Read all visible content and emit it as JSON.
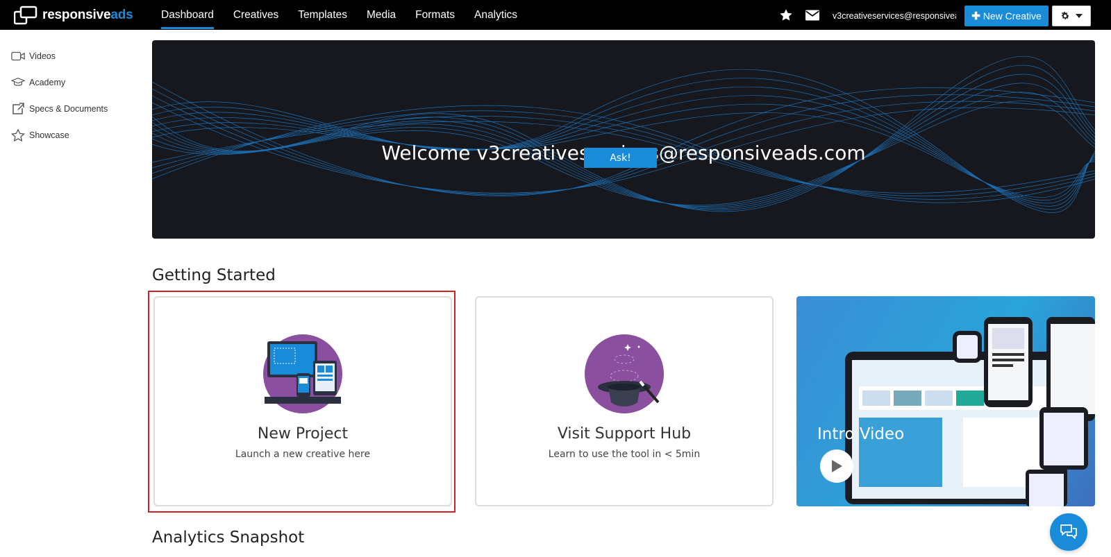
{
  "header": {
    "logo_main": "responsive",
    "logo_accent": "ads",
    "nav": [
      {
        "label": "Dashboard",
        "active": true
      },
      {
        "label": "Creatives"
      },
      {
        "label": "Templates"
      },
      {
        "label": "Media"
      },
      {
        "label": "Formats"
      },
      {
        "label": "Analytics"
      }
    ],
    "user_email": "v3creativeservices@responsivea...",
    "new_creative_label": "New Creative",
    "settings_icon": "gear-icon"
  },
  "sidebar": {
    "items": [
      {
        "label": "Videos",
        "icon": "video-camera-icon"
      },
      {
        "label": "Academy",
        "icon": "graduation-cap-icon"
      },
      {
        "label": "Specs & Documents",
        "icon": "external-link-icon"
      },
      {
        "label": "Showcase",
        "icon": "star-outline-icon"
      }
    ]
  },
  "banner": {
    "welcome": "Welcome v3creativeservices@responsiveads.com",
    "ask_label": "Ask!"
  },
  "getting_started": {
    "title": "Getting Started",
    "cards": [
      {
        "title": "New Project",
        "subtitle": "Launch a new creative here"
      },
      {
        "title": "Visit Support Hub",
        "subtitle": "Learn to use the tool in < 5min"
      }
    ],
    "video": {
      "title": "Intro Video"
    }
  },
  "analytics": {
    "title": "Analytics Snapshot"
  },
  "colors": {
    "accent": "#1a8bd8",
    "selection": "#d0202a",
    "purple": "#8a4f9e"
  }
}
